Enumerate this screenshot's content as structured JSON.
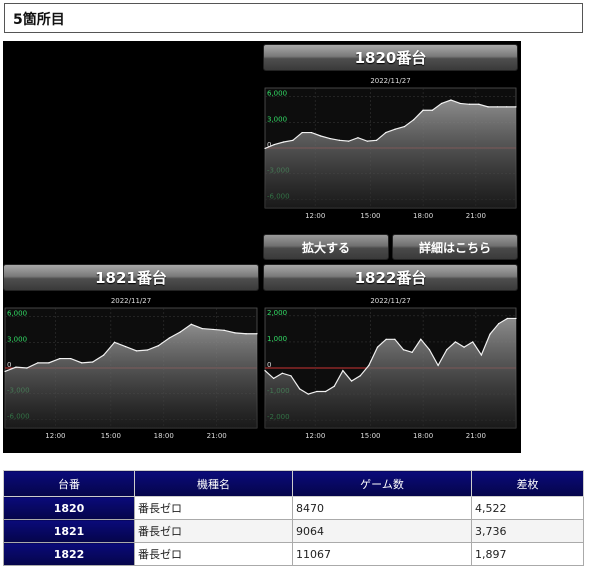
{
  "header": {
    "title": "5箇所目"
  },
  "panels": [
    {
      "title": "1820番台",
      "date": "2022/11/27"
    },
    {
      "title": "1821番台",
      "date": "2022/11/27"
    },
    {
      "title": "1822番台",
      "date": "2022/11/27"
    }
  ],
  "buttons": {
    "zoom": "拡大する",
    "details": "詳細はこちら"
  },
  "table": {
    "headers": [
      "台番",
      "機種名",
      "ゲーム数",
      "差枚"
    ],
    "rows": [
      {
        "num": "1820",
        "model": "番長ゼロ",
        "games": "8470",
        "diff": "4,522"
      },
      {
        "num": "1821",
        "model": "番長ゼロ",
        "games": "9064",
        "diff": "3,736"
      },
      {
        "num": "1822",
        "model": "番長ゼロ",
        "games": "11067",
        "diff": "1,897"
      }
    ]
  },
  "colors": {
    "header_bg": "#05054a",
    "zero_line": "#cc3333",
    "tick_label": "#33dd66"
  },
  "chart_data": [
    {
      "type": "area",
      "title": "2022/11/27",
      "ylim": [
        -7000,
        7000
      ],
      "yticks": [
        "6,000",
        "3,000",
        "0",
        "-3,000",
        "-6,000"
      ],
      "ytick_values": [
        6000,
        3000,
        0,
        -3000,
        -6000
      ],
      "xticks": [
        "12:00",
        "15:00",
        "18:00",
        "21:00"
      ],
      "xtick_pos": [
        0.2,
        0.42,
        0.63,
        0.84
      ],
      "values": [
        -50,
        400,
        700,
        900,
        1800,
        1800,
        1400,
        1100,
        900,
        800,
        1200,
        800,
        900,
        1800,
        2200,
        2500,
        3300,
        4400,
        4400,
        5200,
        5600,
        5200,
        5100,
        5100,
        4800,
        4800,
        4800,
        4800
      ]
    },
    {
      "type": "area",
      "title": "2022/11/27",
      "ylim": [
        -7000,
        7000
      ],
      "yticks": [
        "6,000",
        "3,000",
        "0",
        "-3,000",
        "-6,000"
      ],
      "ytick_values": [
        6000,
        3000,
        0,
        -3000,
        -6000
      ],
      "xticks": [
        "12:00",
        "15:00",
        "18:00",
        "21:00"
      ],
      "xtick_pos": [
        0.2,
        0.42,
        0.63,
        0.84
      ],
      "values": [
        -400,
        100,
        0,
        600,
        600,
        1100,
        1100,
        600,
        700,
        1500,
        3000,
        2500,
        2000,
        2100,
        2600,
        3500,
        4200,
        5100,
        4600,
        4500,
        4400,
        4100,
        4000,
        4000
      ]
    },
    {
      "type": "area",
      "title": "2022/11/27",
      "ylim": [
        -2300,
        2300
      ],
      "yticks": [
        "2,000",
        "1,000",
        "0",
        "-1,000",
        "-2,000"
      ],
      "ytick_values": [
        2000,
        1000,
        0,
        -1000,
        -2000
      ],
      "xticks": [
        "12:00",
        "15:00",
        "18:00",
        "21:00"
      ],
      "xtick_pos": [
        0.2,
        0.42,
        0.63,
        0.84
      ],
      "values": [
        -100,
        -400,
        -200,
        -300,
        -800,
        -1000,
        -900,
        -900,
        -700,
        -100,
        -500,
        -300,
        100,
        800,
        1100,
        1100,
        700,
        600,
        1100,
        700,
        100,
        700,
        1000,
        800,
        1000,
        500,
        1300,
        1700,
        1900,
        1900
      ]
    }
  ]
}
